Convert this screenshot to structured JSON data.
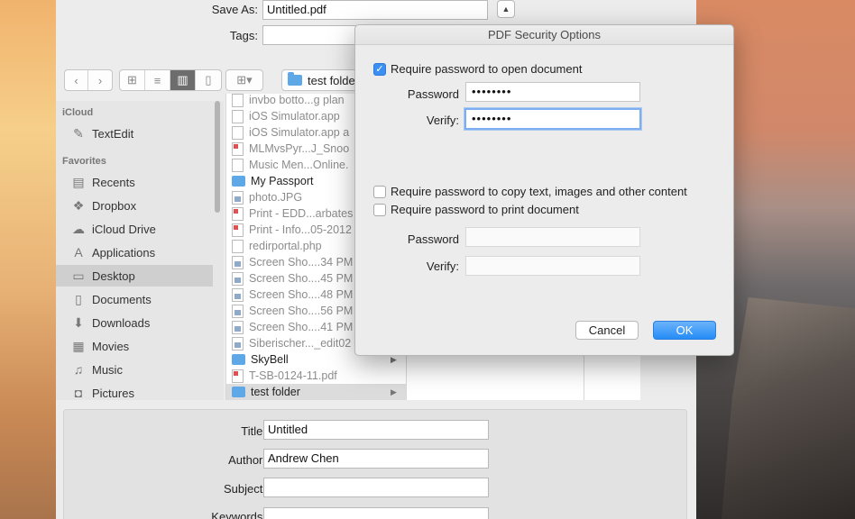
{
  "save_panel": {
    "save_as_label": "Save As:",
    "save_as_value": "Untitled.pdf",
    "tags_label": "Tags:",
    "tags_value": "",
    "current_folder": "test folder"
  },
  "sidebar": {
    "sections": [
      {
        "header": "iCloud",
        "items": [
          {
            "label": "TextEdit",
            "icon": "textedit-icon"
          }
        ]
      },
      {
        "header": "Favorites",
        "items": [
          {
            "label": "Recents",
            "icon": "clock-icon"
          },
          {
            "label": "Dropbox",
            "icon": "dropbox-icon"
          },
          {
            "label": "iCloud Drive",
            "icon": "cloud-icon"
          },
          {
            "label": "Applications",
            "icon": "applications-icon"
          },
          {
            "label": "Desktop",
            "icon": "desktop-icon",
            "selected": true
          },
          {
            "label": "Documents",
            "icon": "document-icon"
          },
          {
            "label": "Downloads",
            "icon": "download-icon"
          },
          {
            "label": "Movies",
            "icon": "film-icon"
          },
          {
            "label": "Music",
            "icon": "music-note-icon"
          },
          {
            "label": "Pictures",
            "icon": "camera-icon"
          }
        ]
      }
    ]
  },
  "files": [
    {
      "name": "invbo botto...g plan",
      "kind": "doc",
      "enabled": false
    },
    {
      "name": "iOS Simulator.app",
      "kind": "doc",
      "enabled": false
    },
    {
      "name": "iOS Simulator.app a",
      "kind": "doc",
      "enabled": false
    },
    {
      "name": "MLMvsPyr...J_Snoo",
      "kind": "pdf",
      "enabled": false
    },
    {
      "name": "Music Men...Online.",
      "kind": "doc",
      "enabled": false
    },
    {
      "name": "My Passport",
      "kind": "folder",
      "enabled": true
    },
    {
      "name": "photo.JPG",
      "kind": "img",
      "enabled": false
    },
    {
      "name": "Print - EDD...arbates",
      "kind": "pdf",
      "enabled": false
    },
    {
      "name": "Print - Info...05-2012",
      "kind": "pdf",
      "enabled": false
    },
    {
      "name": "redirportal.php",
      "kind": "doc",
      "enabled": false
    },
    {
      "name": "Screen Sho....34 PM",
      "kind": "img",
      "enabled": false
    },
    {
      "name": "Screen Sho....45 PM",
      "kind": "img",
      "enabled": false
    },
    {
      "name": "Screen Sho....48 PM",
      "kind": "img",
      "enabled": false
    },
    {
      "name": "Screen Sho....56 PM",
      "kind": "img",
      "enabled": false
    },
    {
      "name": "Screen Sho....41 PM",
      "kind": "img",
      "enabled": false
    },
    {
      "name": "Siberischer..._edit02",
      "kind": "img",
      "enabled": false
    },
    {
      "name": "SkyBell",
      "kind": "folder",
      "enabled": true,
      "arrow": "▶"
    },
    {
      "name": "T-SB-0124-11.pdf",
      "kind": "pdf",
      "enabled": false
    },
    {
      "name": "test folder",
      "kind": "folder",
      "enabled": true,
      "selected": true,
      "arrow": "▶"
    }
  ],
  "metadata": {
    "title_label": "Title:",
    "title_value": "Untitled",
    "author_label": "Author:",
    "author_value": "Andrew Chen",
    "subject_label": "Subject:",
    "subject_value": "",
    "keywords_label": "Keywords:",
    "keywords_value": ""
  },
  "dialog": {
    "title": "PDF Security Options",
    "open_checkbox_label": "Require password to open document",
    "open_checkbox_checked": true,
    "password_label": "Password",
    "password_value": "••••••••",
    "verify_label": "Verify:",
    "verify_value": "••••••••",
    "copy_checkbox_label": "Require password to copy text, images and other content",
    "copy_checkbox_checked": false,
    "print_checkbox_label": "Require password to print document",
    "print_checkbox_checked": false,
    "password2_label": "Password",
    "password2_value": "",
    "verify2_label": "Verify:",
    "verify2_value": "",
    "cancel_label": "Cancel",
    "ok_label": "OK"
  },
  "colors": {
    "accent": "#3b8ff0",
    "panel_bg": "#ececec",
    "sidebar_bg": "#e6e6e6"
  }
}
